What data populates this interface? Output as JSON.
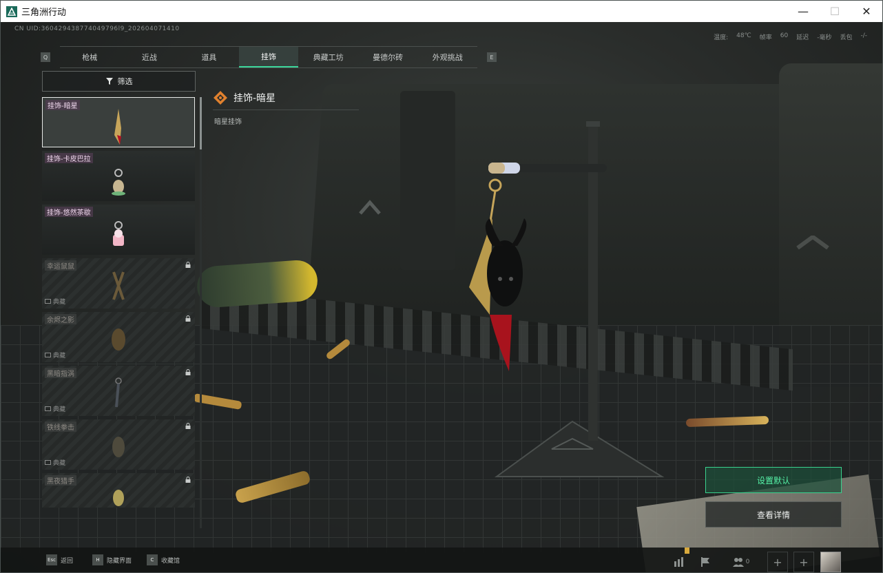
{
  "window": {
    "title": "三角洲行动",
    "minimize_icon": "minimize-icon",
    "maximize_icon": "maximize-icon",
    "close_icon": "close-icon"
  },
  "hud": {
    "uid": "CN UID:360429438774049796l9_202604071410",
    "stats": [
      "温度:",
      "48℃",
      "帧率",
      "60",
      "延迟",
      "-毫秒",
      "丢包",
      "-/-"
    ]
  },
  "tabs": {
    "left_key": "Q",
    "right_key": "E",
    "items": [
      "枪械",
      "近战",
      "道具",
      "挂饰",
      "典藏工坊",
      "曼德尔砖",
      "外观挑战"
    ],
    "active": 3
  },
  "filter": {
    "label": "筛选"
  },
  "list": [
    {
      "label": "挂饰-暗星",
      "selected": true,
      "locked": false,
      "tag": ""
    },
    {
      "label": "挂饰-卡皮巴拉",
      "selected": false,
      "locked": false,
      "tag": ""
    },
    {
      "label": "挂饰-悠然茶歇",
      "selected": false,
      "locked": false,
      "tag": ""
    },
    {
      "label": "幸运鼠鼠",
      "selected": false,
      "locked": true,
      "tag": "典藏"
    },
    {
      "label": "余烬之影",
      "selected": false,
      "locked": true,
      "tag": "典藏"
    },
    {
      "label": "黑暗指涡",
      "selected": false,
      "locked": true,
      "tag": "典藏"
    },
    {
      "label": "铁线拳击",
      "selected": false,
      "locked": true,
      "tag": "典藏"
    },
    {
      "label": "黑夜猎手",
      "selected": false,
      "locked": true,
      "tag": ""
    }
  ],
  "detail": {
    "title": "挂饰-暗星",
    "subtitle": "暗星挂饰"
  },
  "buttons": {
    "set_default": "设置默认",
    "view_details": "查看详情"
  },
  "bottom": {
    "keys": [
      {
        "key": "Esc",
        "label": "返回"
      },
      {
        "key": "H",
        "label": "隐藏界面"
      },
      {
        "key": "C",
        "label": "收藏馆"
      }
    ],
    "friends_count": "0"
  },
  "colors": {
    "accent": "#3bd79b",
    "selected_border": "#e8ebe9"
  }
}
